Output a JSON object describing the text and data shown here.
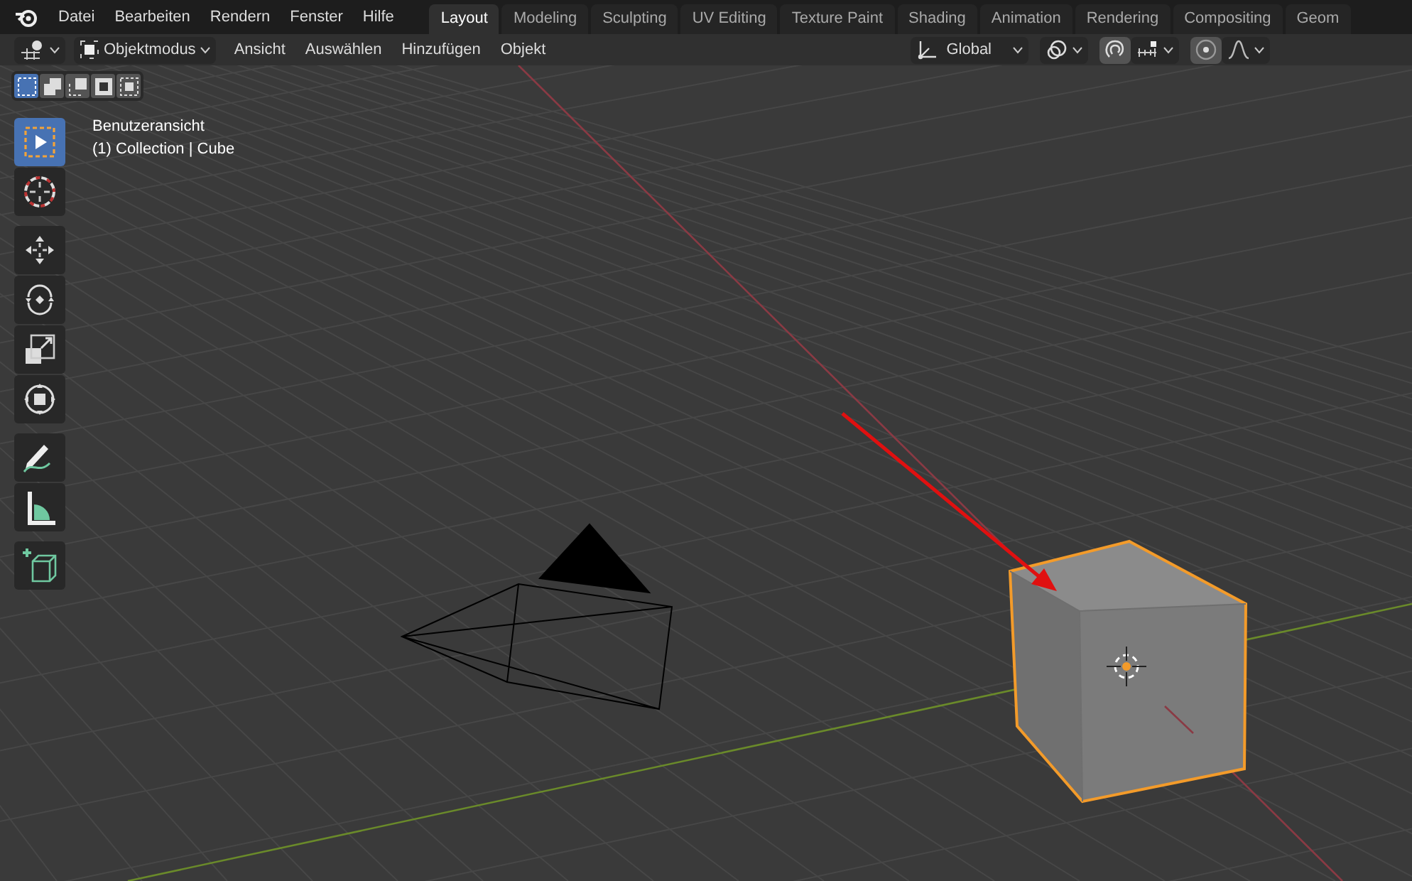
{
  "menu": [
    "Datei",
    "Bearbeiten",
    "Rendern",
    "Fenster",
    "Hilfe"
  ],
  "workspace_tabs": [
    {
      "label": "Layout",
      "selected": true
    },
    {
      "label": "Modeling",
      "selected": false
    },
    {
      "label": "Sculpting",
      "selected": false
    },
    {
      "label": "UV Editing",
      "selected": false
    },
    {
      "label": "Texture Paint",
      "selected": false
    },
    {
      "label": "Shading",
      "selected": false
    },
    {
      "label": "Animation",
      "selected": false
    },
    {
      "label": "Rendering",
      "selected": false
    },
    {
      "label": "Compositing",
      "selected": false
    },
    {
      "label": "Geom",
      "selected": false
    }
  ],
  "header": {
    "mode": "Objektmodus",
    "menus": [
      "Ansicht",
      "Auswählen",
      "Hinzufügen",
      "Objekt"
    ],
    "orientation": "Global",
    "snapping": {
      "on": true
    },
    "proportional_editing": {
      "on": true
    }
  },
  "select_modes": [
    {
      "kind": "new",
      "selected": true
    },
    {
      "kind": "extend",
      "selected": false
    },
    {
      "kind": "subtract",
      "selected": false
    },
    {
      "kind": "invert",
      "selected": false
    },
    {
      "kind": "intersect",
      "selected": false
    }
  ],
  "tool_groups": [
    {
      "tools": [
        {
          "kind": "select",
          "selected": true
        },
        {
          "kind": "cursor",
          "selected": false
        }
      ]
    },
    {
      "tools": [
        {
          "kind": "move",
          "selected": false
        },
        {
          "kind": "rotate",
          "selected": false
        },
        {
          "kind": "scale",
          "selected": false
        },
        {
          "kind": "transform",
          "selected": false
        }
      ]
    },
    {
      "tools": [
        {
          "kind": "annotate",
          "selected": false
        },
        {
          "kind": "measure",
          "selected": false
        }
      ]
    },
    {
      "tools": [
        {
          "kind": "add_cube",
          "selected": false
        }
      ]
    }
  ],
  "viewport": {
    "view_name": "Benutzeransicht",
    "object_info": "(1) Collection | Cube"
  }
}
